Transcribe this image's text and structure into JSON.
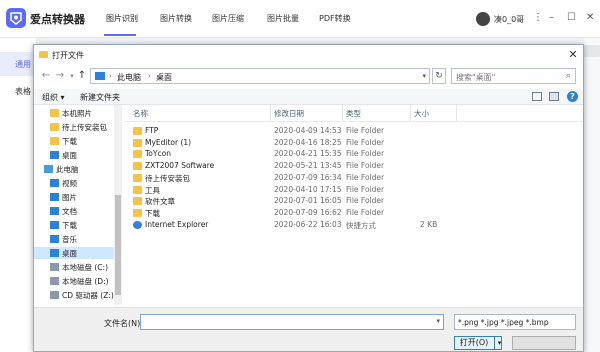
{
  "app": {
    "title": "爱点转换器",
    "tabs": [
      "图片识别",
      "图片转换",
      "图片压缩",
      "图片批量",
      "PDF转换"
    ],
    "user_name": "凑0_0哥",
    "side_items": [
      "通用",
      "表格"
    ]
  },
  "dialog": {
    "title": "打开文件",
    "address": [
      "此电脑",
      "桌面"
    ],
    "search_placeholder": "搜索\"桌面\"",
    "toolbar": {
      "organize": "组织 ▾",
      "new_folder": "新建文件夹"
    },
    "nav": [
      {
        "label": "本机照片",
        "icon": "folder"
      },
      {
        "label": "待上传安装包",
        "icon": "folder"
      },
      {
        "label": "下载",
        "icon": "folder"
      },
      {
        "label": "桌面",
        "icon": "blue"
      },
      {
        "label": "此电脑",
        "icon": "pc"
      },
      {
        "label": "视频",
        "icon": "blue"
      },
      {
        "label": "图片",
        "icon": "blue"
      },
      {
        "label": "文档",
        "icon": "blue"
      },
      {
        "label": "下载",
        "icon": "blue"
      },
      {
        "label": "音乐",
        "icon": "blue"
      },
      {
        "label": "桌面",
        "icon": "blue",
        "selected": true
      },
      {
        "label": "本地磁盘 (C:)",
        "icon": "drive"
      },
      {
        "label": "本地磁盘 (D:)",
        "icon": "drive"
      },
      {
        "label": "CD 驱动器 (Z:)",
        "icon": "drive"
      }
    ],
    "columns": [
      "名称",
      "修改日期",
      "类型",
      "大小"
    ],
    "files": [
      {
        "name": "FTP",
        "date": "2020-04-09 14:53",
        "type": "File Folder",
        "size": ""
      },
      {
        "name": "MyEditor (1)",
        "date": "2020-04-16 18:25",
        "type": "File Folder",
        "size": ""
      },
      {
        "name": "ToYcon",
        "date": "2020-04-21 15:35",
        "type": "File Folder",
        "size": ""
      },
      {
        "name": "ZXT2007 Software",
        "date": "2020-05-21 13:45",
        "type": "File Folder",
        "size": ""
      },
      {
        "name": "待上传安装包",
        "date": "2020-07-09 16:34",
        "type": "File Folder",
        "size": ""
      },
      {
        "name": "工具",
        "date": "2020-04-10 17:15",
        "type": "File Folder",
        "size": ""
      },
      {
        "name": "软件文章",
        "date": "2020-07-01 16:05",
        "type": "File Folder",
        "size": ""
      },
      {
        "name": "下载",
        "date": "2020-07-09 16:62",
        "type": "File Folder",
        "size": ""
      },
      {
        "name": "Internet  Explorer",
        "date": "2020-06-22 16:03",
        "type": "快捷方式",
        "size": "2 KB",
        "icon": "ie"
      }
    ],
    "filename_label": "文件名(N):",
    "filename_value": "",
    "filetype": "*.png *.jpg *.jpeg *.bmp",
    "open_label": "打开(O)"
  }
}
